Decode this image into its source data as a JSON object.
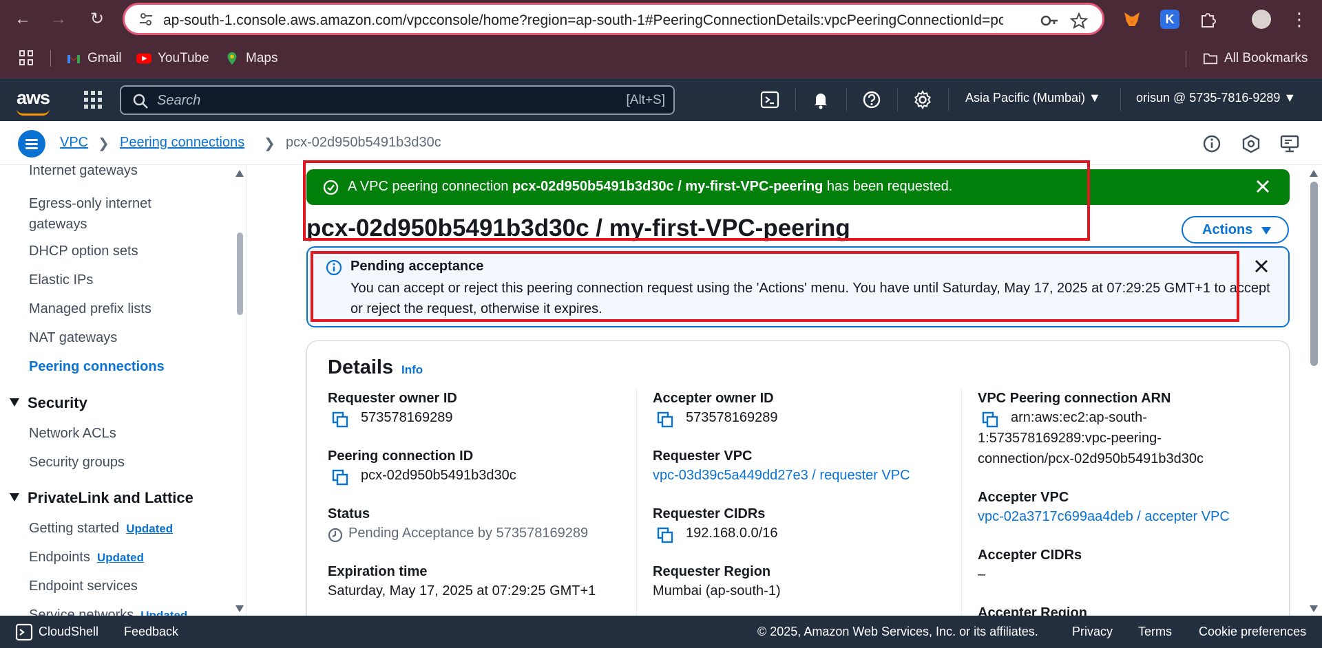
{
  "browser": {
    "url": "ap-south-1.console.aws.amazon.com/vpcconsole/home?region=ap-south-1#PeeringConnectionDetails:vpcPeeringConnectionId=pcx-...",
    "bookmarks": [
      "Gmail",
      "YouTube",
      "Maps"
    ],
    "all_bookmarks": "All Bookmarks"
  },
  "aws_nav": {
    "logo": "aws",
    "search_placeholder": "Search",
    "search_shortcut": "[Alt+S]",
    "region": "Asia Pacific (Mumbai)",
    "account": "orisun @ 5735-7816-9289"
  },
  "breadcrumb": {
    "items": [
      "VPC",
      "Peering connections"
    ],
    "current": "pcx-02d950b5491b3d30c"
  },
  "sidebar": {
    "items_top": [
      "Internet gateways",
      "Egress-only internet gateways",
      "DHCP option sets",
      "Elastic IPs",
      "Managed prefix lists",
      "NAT gateways",
      "Peering connections"
    ],
    "security_heading": "Security",
    "security_items": [
      "Network ACLs",
      "Security groups"
    ],
    "privatelink_heading": "PrivateLink and Lattice",
    "privatelink_items": [
      "Getting started",
      "Endpoints",
      "Endpoint services",
      "Service networks"
    ],
    "badge": "Updated"
  },
  "flash": {
    "prefix": "A VPC peering connection ",
    "bold": "pcx-02d950b5491b3d30c / my-first-VPC-peering",
    "suffix": " has been requested."
  },
  "page_title": "pcx-02d950b5491b3d30c / my-first-VPC-peering",
  "actions_label": "Actions",
  "alert": {
    "title": "Pending acceptance",
    "body": "You can accept or reject this peering connection request using the 'Actions' menu. You have until Saturday, May 17, 2025 at 07:29:25 GMT+1 to accept or reject the request, otherwise it expires."
  },
  "details": {
    "title": "Details",
    "info": "Info",
    "col1": {
      "requester_owner_label": "Requester owner ID",
      "requester_owner_value": "573578169289",
      "peering_id_label": "Peering connection ID",
      "peering_id_value": "pcx-02d950b5491b3d30c",
      "status_label": "Status",
      "status_value": "Pending Acceptance by 573578169289",
      "expiration_label": "Expiration time",
      "expiration_value": "Saturday, May 17, 2025 at 07:29:25 GMT+1"
    },
    "col2": {
      "accepter_owner_label": "Accepter owner ID",
      "accepter_owner_value": "573578169289",
      "requester_vpc_label": "Requester VPC",
      "requester_vpc_value": "vpc-03d39c5a449dd27e3 / requester VPC",
      "requester_cidrs_label": "Requester CIDRs",
      "requester_cidrs_value": "192.168.0.0/16",
      "requester_region_label": "Requester Region",
      "requester_region_value": "Mumbai (ap-south-1)"
    },
    "col3": {
      "arn_label": "VPC Peering connection ARN",
      "arn_line1": "arn:aws:ec2:ap-south-",
      "arn_line2": "1:573578169289:vpc-peering-",
      "arn_line3": "connection/pcx-02d950b5491b3d30c",
      "accepter_vpc_label": "Accepter VPC",
      "accepter_vpc_value": "vpc-02a3717c699aa4deb / accepter VPC",
      "accepter_cidrs_label": "Accepter CIDRs",
      "accepter_cidrs_value": "–",
      "accepter_region_label": "Accepter Region"
    }
  },
  "footer": {
    "cloudshell": "CloudShell",
    "feedback": "Feedback",
    "copyright": "© 2025, Amazon Web Services, Inc. or its affiliates.",
    "privacy": "Privacy",
    "terms": "Terms",
    "cookies": "Cookie preferences"
  },
  "colors": {
    "aws_nav_bg": "#232f3e",
    "link_blue": "#0972d3",
    "success_green": "#037f0c",
    "highlight_red": "#e4161f",
    "browser_bg": "#4a2a36"
  }
}
